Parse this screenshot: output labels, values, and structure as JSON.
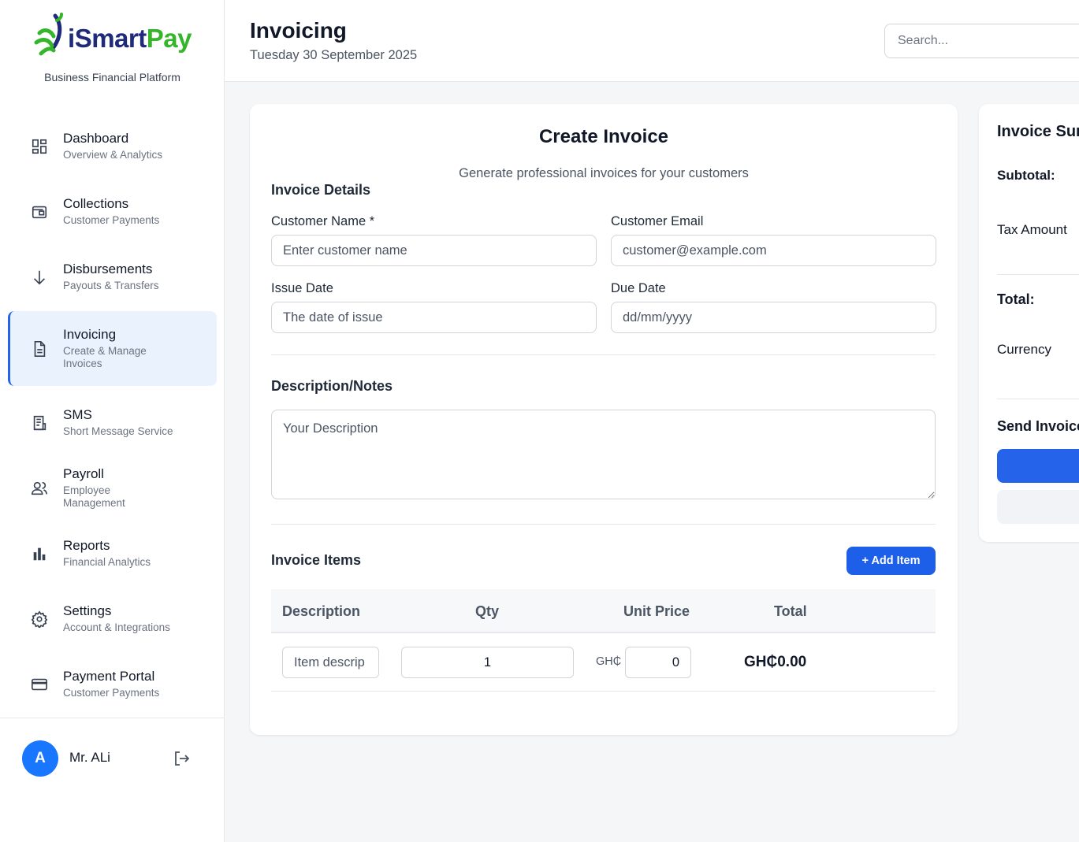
{
  "brand": {
    "logo_i": "i",
    "logo_smart": "Smart",
    "logo_pay": "Pay",
    "tagline": "Business Financial Platform",
    "colors": {
      "navy": "#1f2a7a",
      "green": "#35b529",
      "accent": "#2563eb"
    }
  },
  "sidebar": {
    "items": [
      {
        "title": "Dashboard",
        "sub": "Overview & Analytics",
        "icon": "dashboard-icon"
      },
      {
        "title": "Collections",
        "sub": "Customer Payments",
        "icon": "wallet-icon"
      },
      {
        "title": "Disbursements",
        "sub": "Payouts & Transfers",
        "icon": "arrow-down-icon"
      },
      {
        "title": "Invoicing",
        "sub": "Create & Manage Invoices",
        "icon": "document-icon",
        "active": true
      },
      {
        "title": "SMS",
        "sub": "Short Message Service",
        "icon": "receipt-icon"
      },
      {
        "title": "Payroll",
        "sub": "Employee Management",
        "icon": "users-icon"
      },
      {
        "title": "Reports",
        "sub": "Financial Analytics",
        "icon": "bar-chart-icon"
      },
      {
        "title": "Settings",
        "sub": "Account & Integrations",
        "icon": "gear-icon"
      },
      {
        "title": "Payment Portal",
        "sub": "Customer Payments",
        "icon": "credit-card-icon"
      }
    ],
    "user": {
      "initial": "A",
      "name": "Mr. ALi"
    }
  },
  "header": {
    "title": "Invoicing",
    "date": "Tuesday 30 September 2025",
    "search_placeholder": "Search..."
  },
  "invoice": {
    "title": "Create Invoice",
    "subtitle": "Generate professional invoices for your customers",
    "details_heading": "Invoice Details",
    "customer_name_label": "Customer Name *",
    "customer_name_placeholder": "Enter customer name",
    "customer_email_label": "Customer Email",
    "customer_email_placeholder": "customer@example.com",
    "issue_date_label": "Issue Date",
    "issue_date_placeholder": "The date of issue",
    "due_date_label": "Due Date",
    "due_date_placeholder": "dd/mm/yyyy",
    "notes_heading": "Description/Notes",
    "notes_placeholder": "Your Description",
    "items_heading": "Invoice Items",
    "add_item_label": "+ Add Item",
    "columns": [
      "Description",
      "Qty",
      "Unit Price",
      "Total"
    ],
    "row": {
      "desc_placeholder": "Item descrip",
      "qty": "1",
      "currency": "GH₵",
      "unit_price": "0",
      "total": "GH₵0.00"
    }
  },
  "summary": {
    "title": "Invoice Summary",
    "subtotal_label": "Subtotal:",
    "tax_label": "Tax Amount",
    "total_label": "Total:",
    "currency_label": "Currency",
    "send_label": "Send Invoice"
  }
}
